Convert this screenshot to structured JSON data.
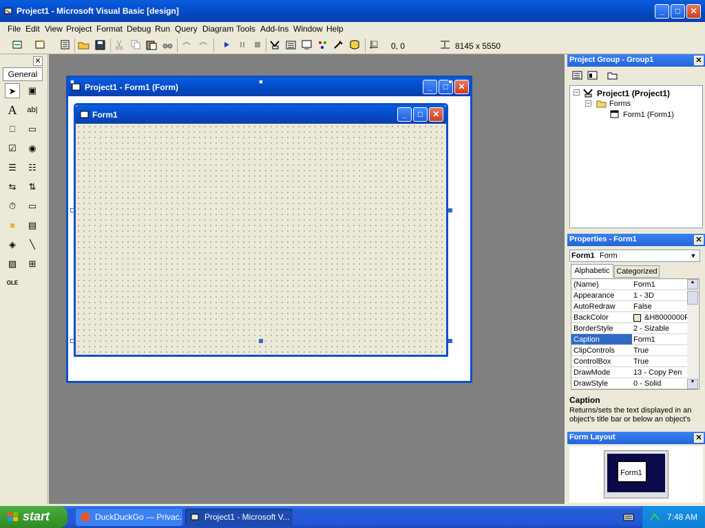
{
  "app": {
    "title": "Project1 - Microsoft Visual Basic [design]"
  },
  "menu": {
    "items": [
      "File",
      "Edit",
      "View",
      "Project",
      "Format",
      "Debug",
      "Run",
      "Query",
      "Diagram",
      "Tools",
      "Add-Ins",
      "Window",
      "Help"
    ]
  },
  "toolbar": {
    "position": "0, 0",
    "size": "8145 x 5550"
  },
  "toolbox": {
    "tab_label": "General"
  },
  "designer": {
    "window_title": "Project1 - Form1 (Form)",
    "form_caption": "Form1"
  },
  "project_group": {
    "title": "Project Group - Group1",
    "tree": {
      "project": "Project1 (Project1)",
      "folder": "Forms",
      "form": "Form1 (Form1)"
    }
  },
  "properties": {
    "title": "Properties - Form1",
    "object_name": "Form1",
    "object_type": "Form",
    "tabs": [
      "Alphabetic",
      "Categorized"
    ],
    "rows": [
      {
        "k": "(Name)",
        "v": "Form1"
      },
      {
        "k": "Appearance",
        "v": "1 - 3D"
      },
      {
        "k": "AutoRedraw",
        "v": "False"
      },
      {
        "k": "BackColor",
        "v": "&H8000000F"
      },
      {
        "k": "BorderStyle",
        "v": "2 - Sizable"
      },
      {
        "k": "Caption",
        "v": "Form1"
      },
      {
        "k": "ClipControls",
        "v": "True"
      },
      {
        "k": "ControlBox",
        "v": "True"
      },
      {
        "k": "DrawMode",
        "v": "13 - Copy Pen"
      },
      {
        "k": "DrawStyle",
        "v": "0 - Solid"
      }
    ],
    "selected_index": 5,
    "desc_title": "Caption",
    "desc_text": "Returns/sets the text displayed in an object's title bar or below an object's"
  },
  "form_layout": {
    "title": "Form Layout",
    "preview_label": "Form1"
  },
  "taskbar": {
    "start_label": "start",
    "tasks": [
      "DuckDuckGo — Privac...",
      "Project1 - Microsoft V..."
    ],
    "clock": "7:48 AM"
  },
  "colors": {
    "title_blue": "#0a5fd6",
    "mdi_gray": "#808080",
    "selection": "#316ac5",
    "taskbar": "#245ed8",
    "start_green": "#3c9b31"
  }
}
